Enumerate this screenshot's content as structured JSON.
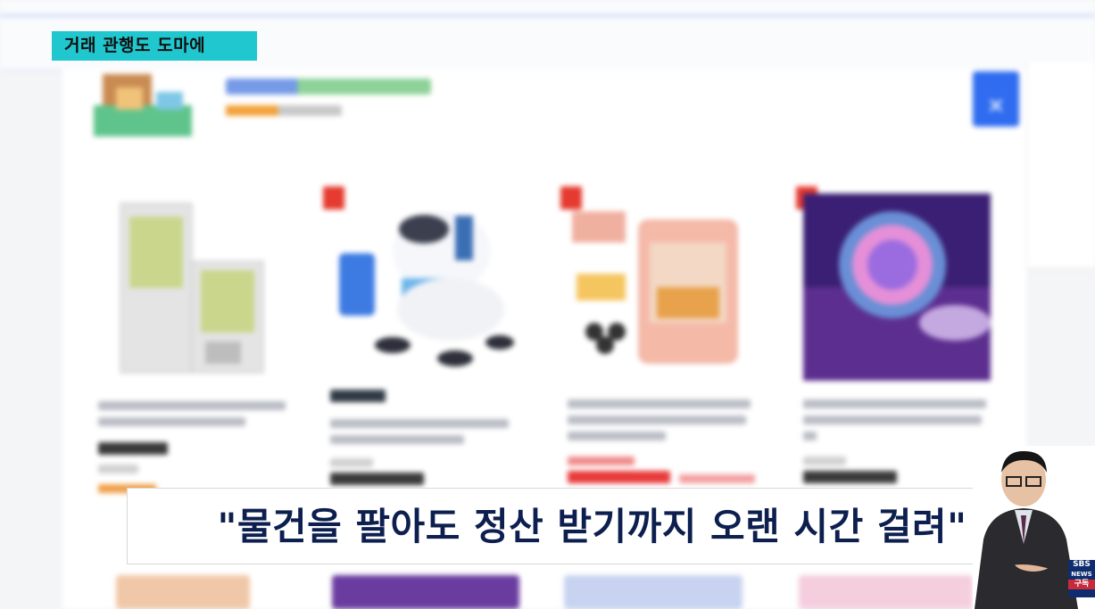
{
  "news_tag": "거래 관행도 도마에",
  "subtitle": "\"물건을 팔아도 정산 받기까지 오랜 시간 걸려\"",
  "logo": {
    "line1": "SBS",
    "line2": "NEWS",
    "line3": "구독"
  },
  "colors": {
    "tag_bg": "#20c7cf",
    "subtitle_text": "#0d1f4f",
    "rank_badge": "#e53a2f",
    "accent_blue": "#2f6cf0"
  }
}
